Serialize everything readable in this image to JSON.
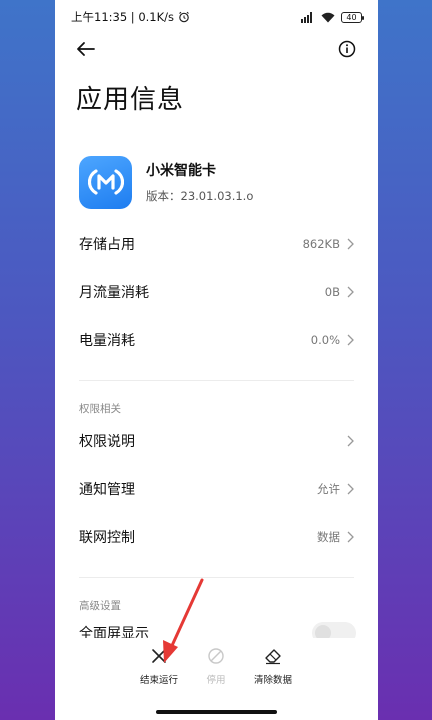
{
  "status_bar": {
    "time_speed": "上午11:35 | 0.1K/s",
    "battery": "40"
  },
  "icons": {
    "back": "back-arrow-icon",
    "info": "info-icon",
    "alarm": "alarm-clock-icon",
    "signal": "signal-icon",
    "wifi": "wifi-icon",
    "app": "xiaomi-smart-card-icon",
    "stop": "close-icon",
    "disable": "disable-icon",
    "clear": "eraser-icon",
    "chevron": "chevron-right-icon"
  },
  "page": {
    "title": "应用信息"
  },
  "app": {
    "name": "小米智能卡",
    "version": "版本：23.01.03.1.o"
  },
  "rows_primary": [
    {
      "label": "存储占用",
      "value": "862KB"
    },
    {
      "label": "月流量消耗",
      "value": "0B"
    },
    {
      "label": "电量消耗",
      "value": "0.0%"
    }
  ],
  "permissions": {
    "section_title": "权限相关",
    "rows": [
      {
        "label": "权限说明",
        "value": ""
      },
      {
        "label": "通知管理",
        "value": "允许"
      },
      {
        "label": "联网控制",
        "value": "数据"
      }
    ]
  },
  "advanced": {
    "section_title": "高级设置",
    "fullscreen_label": "全面屏显示"
  },
  "bottom_actions": {
    "stop": "结束运行",
    "disable": "停用",
    "clear": "清除数据"
  },
  "colors": {
    "accent_blue": "#1e7df0",
    "annotation_red": "#e53935"
  }
}
